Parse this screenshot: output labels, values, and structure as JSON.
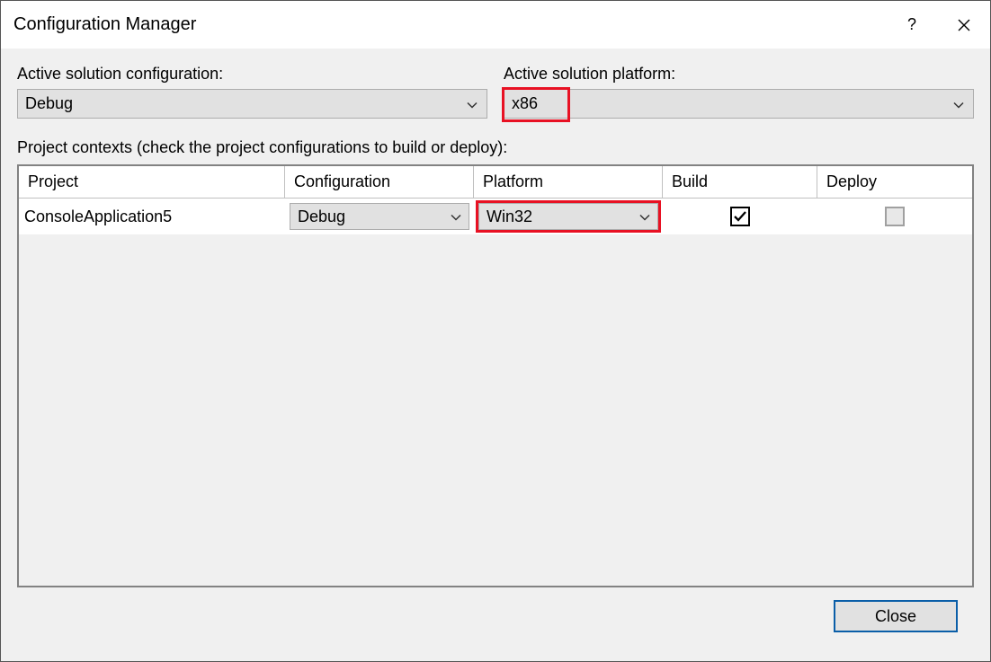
{
  "window": {
    "title": "Configuration Manager"
  },
  "labels": {
    "activeConfig": "Active solution configuration:",
    "activePlatform": "Active solution platform:",
    "contexts": "Project contexts (check the project configurations to build or deploy):"
  },
  "dropdowns": {
    "activeConfig": "Debug",
    "activePlatform": "x86"
  },
  "columns": {
    "project": "Project",
    "configuration": "Configuration",
    "platform": "Platform",
    "build": "Build",
    "deploy": "Deploy"
  },
  "rows": [
    {
      "project": "ConsoleApplication5",
      "configuration": "Debug",
      "platform": "Win32",
      "build": true,
      "deployEnabled": false
    }
  ],
  "buttons": {
    "close": "Close"
  }
}
